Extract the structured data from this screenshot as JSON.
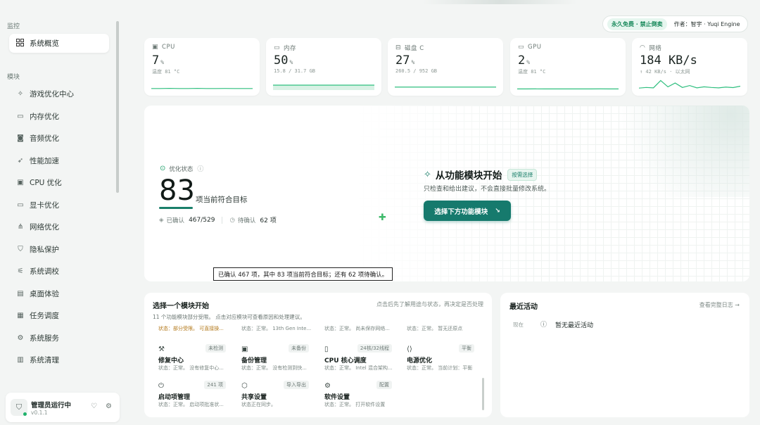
{
  "sidebar": {
    "section_monitor": "监控",
    "active_item": "系统概览",
    "section_modules": "模块",
    "items": [
      {
        "label": "游戏优化中心",
        "icon": "sparkle-icon"
      },
      {
        "label": "内存优化",
        "icon": "memory-icon"
      },
      {
        "label": "音频优化",
        "icon": "speaker-icon"
      },
      {
        "label": "性能加速",
        "icon": "rocket-icon"
      },
      {
        "label": "CPU 优化",
        "icon": "cpu-icon"
      },
      {
        "label": "显卡优化",
        "icon": "monitor-icon"
      },
      {
        "label": "网络优化",
        "icon": "network-icon"
      },
      {
        "label": "隐私保护",
        "icon": "shield-icon"
      },
      {
        "label": "系统调校",
        "icon": "sliders-icon"
      },
      {
        "label": "桌面体验",
        "icon": "desktop-icon"
      },
      {
        "label": "任务调度",
        "icon": "calendar-icon"
      },
      {
        "label": "系统服务",
        "icon": "services-icon"
      },
      {
        "label": "系统清理",
        "icon": "trash-icon"
      }
    ],
    "footer": {
      "title": "管理员运行中",
      "version": "v0.1.1"
    }
  },
  "top_badge": {
    "free": "永久免费 · 禁止倒卖",
    "author": "作者：智宇 · Yuqi Engine"
  },
  "stats": [
    {
      "label": "CPU",
      "value": "7",
      "unit": "%",
      "sub": "温度 81 °C",
      "icon": "cpu-icon",
      "spark": [
        0.1,
        0.1,
        0.12,
        0.1,
        0.1,
        0.12,
        0.1,
        0.1,
        0.11,
        0.1,
        0.1,
        0.1
      ]
    },
    {
      "label": "内存",
      "value": "50",
      "unit": "%",
      "sub": "15.8 / 31.7 GB",
      "icon": "memory-icon",
      "spark": [
        0.5,
        0.5,
        0.5,
        0.5,
        0.5,
        0.5,
        0.5,
        0.5,
        0.5,
        0.5,
        0.5,
        0.5
      ]
    },
    {
      "label": "磁盘 C",
      "value": "27",
      "unit": "%",
      "sub": "260.5 / 952 GB",
      "icon": "disk-icon",
      "spark": [
        0.27,
        0.27,
        0.27,
        0.27,
        0.27,
        0.27,
        0.27,
        0.27,
        0.27,
        0.27,
        0.27,
        0.27
      ]
    },
    {
      "label": "GPU",
      "value": "2",
      "unit": "%",
      "sub": "温度 81 °C",
      "icon": "monitor-icon",
      "spark": [
        0.05,
        0.05,
        0.06,
        0.05,
        0.05,
        0.05,
        0.05,
        0.05,
        0.05,
        0.06,
        0.05,
        0.05
      ]
    },
    {
      "label": "网络",
      "value": "184 KB/s",
      "unit": "",
      "sub": "↑ 42 KB/s · 以太网",
      "icon": "wifi-icon",
      "spark": [
        0.1,
        0.15,
        0.12,
        0.7,
        0.2,
        0.5,
        0.15,
        0.3,
        0.12,
        0.2,
        0.15,
        0.12,
        0.18,
        0.14,
        0.25
      ]
    }
  ],
  "hero": {
    "status_label": "优化状态",
    "score": "83",
    "score_caption": "项当前符合目标",
    "confirmed_label": "已确认",
    "confirmed_value": "467/529",
    "pending_label": "待确认",
    "pending_value": "62 项",
    "start_title": "从功能模块开始",
    "recommend": "按需选择",
    "start_sub": "只检查和给出建议，不会直接批量修改系统。",
    "start_button": "选择下方功能模块",
    "tooltip": "已确认 467 项，其中 83 项当前符合目标；还有 62 项待确认。"
  },
  "modules": {
    "title": "选择一个模块开始",
    "hint": "点击后先了解用途与状态，再决定是否处理",
    "desc": "11 个功能模块部分受限。 点击对应模块可查看原因和处理建议。",
    "top_statuses": [
      "状态：部分受限。 可直接操...",
      "状态：正常。 13th Gen Inte...",
      "状态：正常。 尚未保存网络...",
      "状态：正常。 暂无还原点"
    ],
    "items": [
      {
        "name": "修复中心",
        "tag": "未检测",
        "status": "状态：正常。 没有修复中心...",
        "icon": "wrench-icon"
      },
      {
        "name": "备份管理",
        "tag": "未备份",
        "status": "状态：正常。 没有检测到快...",
        "icon": "save-icon"
      },
      {
        "name": "CPU 核心调度",
        "tag": "24核/32线程",
        "status": "状态：正常。 Intel 混合架构...",
        "icon": "phone-icon"
      },
      {
        "name": "电源优化",
        "tag": "平衡",
        "status": "状态：正常。 当前计划：平衡",
        "icon": "power-plug-icon"
      },
      {
        "name": "启动项管理",
        "tag": "241 项",
        "status": "状态：正常。 启动项批准状...",
        "icon": "power-icon"
      },
      {
        "name": "共享设置",
        "tag": "导入导出",
        "status": "状态正在同步。",
        "icon": "box-icon"
      },
      {
        "name": "软件设置",
        "tag": "配置",
        "status": "状态：正常。 打开软件设置",
        "icon": "gear-icon"
      }
    ]
  },
  "activity": {
    "title": "最近活动",
    "link": "查看完整日志 →",
    "time": "现在",
    "empty": "暂无最近活动"
  },
  "colors": {
    "accent": "#167a6d",
    "spark": "#2fbf7f",
    "ok": "#1fb26b",
    "warn": "#b3781a"
  }
}
